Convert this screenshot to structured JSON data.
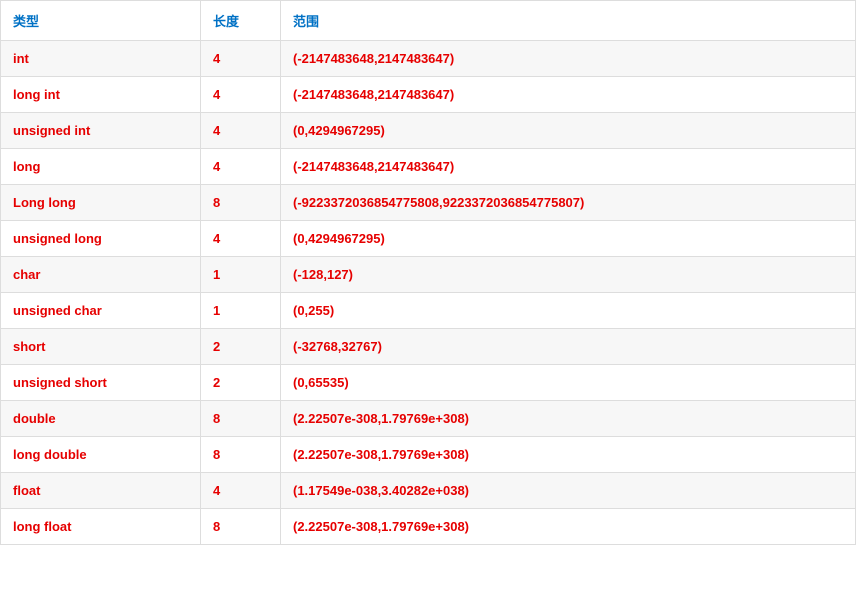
{
  "headers": {
    "type": "类型",
    "length": "长度",
    "range": "范围"
  },
  "rows": [
    {
      "type": "int",
      "length": "4",
      "range": "(-2147483648,2147483647)"
    },
    {
      "type": "long int",
      "length": "4",
      "range": "(-2147483648,2147483647)"
    },
    {
      "type": "unsigned int",
      "length": "4",
      "range": "(0,4294967295)"
    },
    {
      "type": "long",
      "length": "4",
      "range": "(-2147483648,2147483647)"
    },
    {
      "type": "Long long",
      "length": "8",
      "range": "(-9223372036854775808,9223372036854775807)"
    },
    {
      "type": "unsigned long",
      "length": "4",
      "range": "(0,4294967295)"
    },
    {
      "type": "char",
      "length": "1",
      "range": "(-128,127)"
    },
    {
      "type": "unsigned char",
      "length": "1",
      "range": "(0,255)"
    },
    {
      "type": "short",
      "length": "2",
      "range": "(-32768,32767)"
    },
    {
      "type": "unsigned short",
      "length": "2",
      "range": "(0,65535)"
    },
    {
      "type": "double",
      "length": "8",
      "range": "(2.22507e-308,1.79769e+308)"
    },
    {
      "type": "long double",
      "length": "8",
      "range": "(2.22507e-308,1.79769e+308)"
    },
    {
      "type": "float",
      "length": "4",
      "range": "(1.17549e-038,3.40282e+038)"
    },
    {
      "type": "long float",
      "length": "8",
      "range": "(2.22507e-308,1.79769e+308)"
    }
  ]
}
